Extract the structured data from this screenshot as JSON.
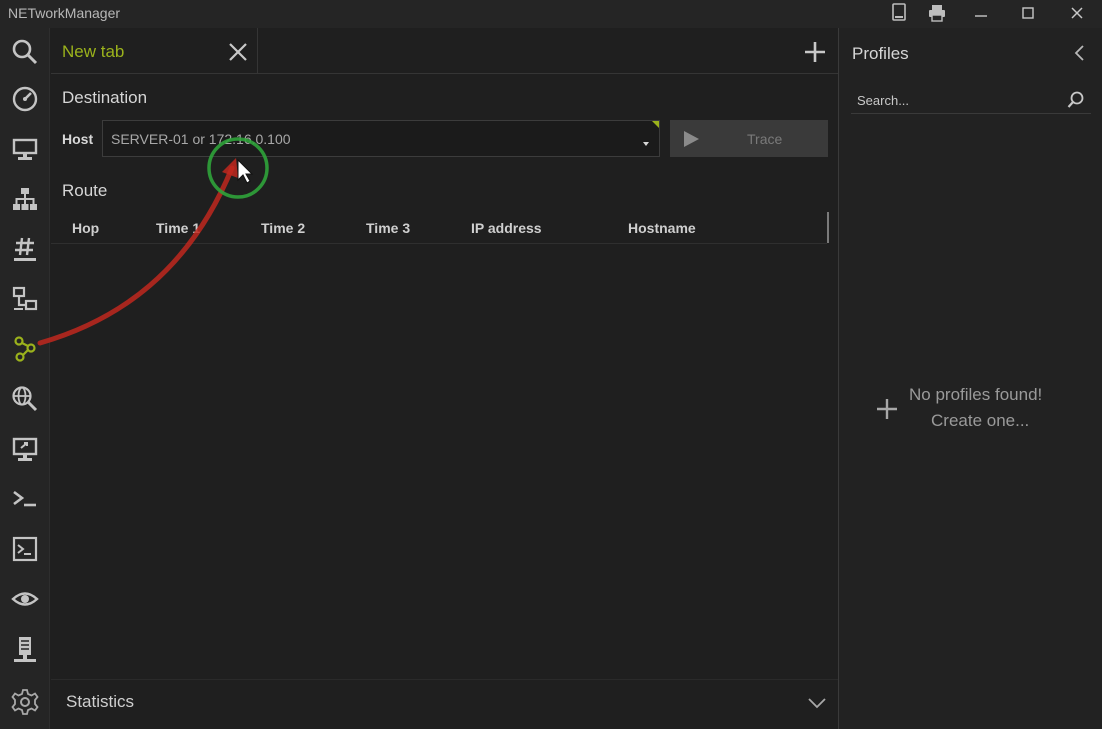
{
  "window": {
    "title": "NETworkManager",
    "controls": [
      "device-icon",
      "print-icon",
      "minimize-icon",
      "maximize-icon",
      "close-icon"
    ]
  },
  "sidebar": {
    "items": [
      {
        "icon": "search-icon"
      },
      {
        "icon": "dashboard-icon"
      },
      {
        "icon": "network-interface-icon"
      },
      {
        "icon": "ip-scanner-icon"
      },
      {
        "icon": "subnet-hash-icon"
      },
      {
        "icon": "port-scanner-icon"
      },
      {
        "icon": "traceroute-icon",
        "active": true
      },
      {
        "icon": "dns-lookup-icon"
      },
      {
        "icon": "remote-desktop-icon"
      },
      {
        "icon": "powershell-icon"
      },
      {
        "icon": "terminal-icon"
      },
      {
        "icon": "visibility-icon"
      },
      {
        "icon": "server-icon"
      },
      {
        "icon": "settings-gear-icon"
      }
    ]
  },
  "tabs": {
    "items": [
      {
        "label": "New tab",
        "active": true
      }
    ]
  },
  "destination": {
    "section_label": "Destination",
    "host_label": "Host",
    "host_placeholder": "SERVER-01 or 172.16.0.100",
    "trace_label": "Trace"
  },
  "route": {
    "section_label": "Route",
    "columns": [
      "Hop",
      "Time 1",
      "Time 2",
      "Time 3",
      "IP address",
      "Hostname"
    ],
    "rows": []
  },
  "statistics": {
    "label": "Statistics"
  },
  "profiles": {
    "title": "Profiles",
    "search_placeholder": "Search...",
    "empty_line1": "No profiles found!",
    "empty_line2": "Create one..."
  },
  "colors": {
    "accent": "#9bb21c",
    "background": "#1f1f1f",
    "annotation_arrow": "#c0281e",
    "annotation_circle": "#2fa33a"
  }
}
